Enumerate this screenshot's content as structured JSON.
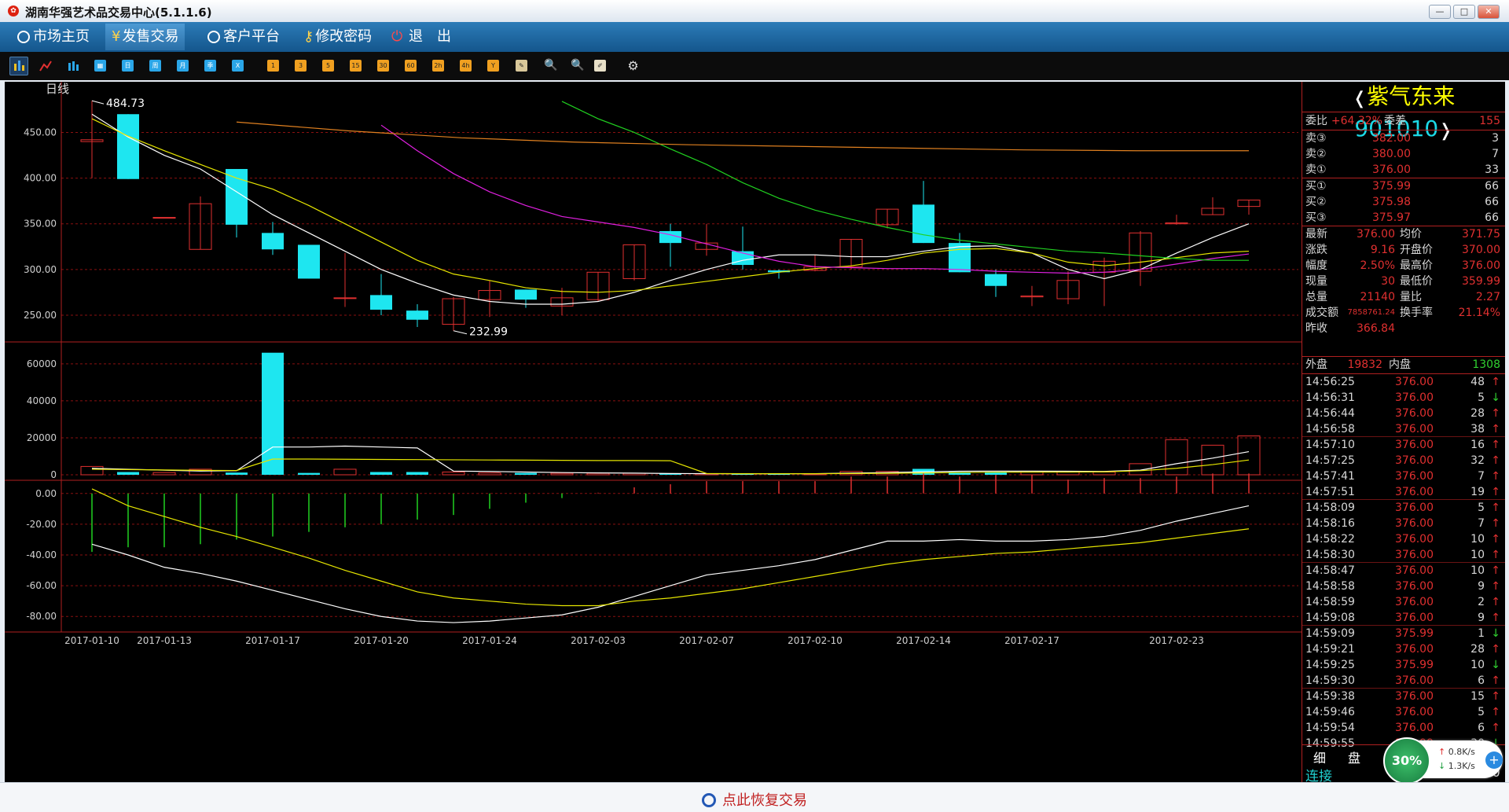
{
  "window": {
    "title": "湖南华强艺术品交易中心(5.1.1.6)"
  },
  "menu": [
    {
      "label": "市场主页",
      "icon": "home-icon"
    },
    {
      "label": "发售交易",
      "icon": "yen-icon"
    },
    {
      "label": "客户平台",
      "icon": "platform-icon"
    },
    {
      "label": "修改密码",
      "icon": "key-icon"
    },
    {
      "label": "退　出",
      "icon": "power-icon"
    }
  ],
  "toolbar": {
    "buttons": [
      "日",
      "周",
      "月",
      "季",
      "X",
      "1",
      "3",
      "5",
      "15",
      "30",
      "60",
      "2h",
      "4h",
      "Y"
    ]
  },
  "chart_data": {
    "type": "candlestick",
    "period_label": "日线",
    "high_label": "484.73",
    "low_label": "232.99",
    "price_axis": [
      "450.00",
      "400.00",
      "350.00",
      "300.00",
      "250.00"
    ],
    "volume_axis": [
      "60000",
      "40000",
      "20000",
      "0"
    ],
    "macd_axis": [
      "0.00",
      "-20.00",
      "-40.00",
      "-60.00",
      "-80.00"
    ],
    "x_labels": [
      "2017-01-10",
      "2017-01-13",
      "2017-01-17",
      "2017-01-20",
      "2017-01-24",
      "2017-02-03",
      "2017-02-07",
      "2017-02-10",
      "2017-02-14",
      "2017-02-17",
      "2017-02-23"
    ],
    "candles": [
      {
        "o": 440,
        "c": 442,
        "h": 484.73,
        "l": 400
      },
      {
        "o": 470,
        "c": 399,
        "h": 470,
        "l": 399
      },
      {
        "o": 357,
        "c": 357,
        "h": 357,
        "l": 357
      },
      {
        "o": 322,
        "c": 372,
        "h": 380,
        "l": 322
      },
      {
        "o": 410,
        "c": 349,
        "h": 410,
        "l": 335
      },
      {
        "o": 340,
        "c": 322,
        "h": 352,
        "l": 316
      },
      {
        "o": 327,
        "c": 290,
        "h": 327,
        "l": 290
      },
      {
        "o": 269,
        "c": 269,
        "h": 318,
        "l": 259
      },
      {
        "o": 272,
        "c": 256,
        "h": 295,
        "l": 250
      },
      {
        "o": 255,
        "c": 245,
        "h": 262,
        "l": 237
      },
      {
        "o": 240,
        "c": 268,
        "h": 270,
        "l": 232.99
      },
      {
        "o": 267,
        "c": 277,
        "h": 288,
        "l": 248
      },
      {
        "o": 278,
        "c": 267,
        "h": 278,
        "l": 258
      },
      {
        "o": 260,
        "c": 269,
        "h": 280,
        "l": 250
      },
      {
        "o": 267,
        "c": 297,
        "h": 297,
        "l": 265
      },
      {
        "o": 290,
        "c": 327,
        "h": 327,
        "l": 288
      },
      {
        "o": 342,
        "c": 329,
        "h": 350,
        "l": 303
      },
      {
        "o": 322,
        "c": 329,
        "h": 350,
        "l": 315
      },
      {
        "o": 320,
        "c": 305,
        "h": 347,
        "l": 300
      },
      {
        "o": 299,
        "c": 297,
        "h": 300,
        "l": 290
      },
      {
        "o": 299,
        "c": 303,
        "h": 316,
        "l": 298
      },
      {
        "o": 303,
        "c": 333,
        "h": 333,
        "l": 300
      },
      {
        "o": 349,
        "c": 366,
        "h": 366,
        "l": 345
      },
      {
        "o": 371,
        "c": 329,
        "h": 397,
        "l": 329
      },
      {
        "o": 329,
        "c": 297,
        "h": 340,
        "l": 297
      },
      {
        "o": 295,
        "c": 282,
        "h": 300,
        "l": 270
      },
      {
        "o": 270,
        "c": 271,
        "h": 282,
        "l": 260
      },
      {
        "o": 268,
        "c": 288,
        "h": 298,
        "l": 262
      },
      {
        "o": 297,
        "c": 309,
        "h": 313,
        "l": 260
      },
      {
        "o": 298,
        "c": 340,
        "h": 342,
        "l": 282
      },
      {
        "o": 350,
        "c": 351,
        "h": 360,
        "l": 349
      },
      {
        "o": 360,
        "c": 367,
        "h": 379,
        "l": 360
      },
      {
        "o": 369,
        "c": 376,
        "h": 376,
        "l": 359.99
      }
    ],
    "ma5": [
      470,
      445,
      425,
      410,
      385,
      360,
      340,
      320,
      300,
      285,
      272,
      265,
      262,
      262,
      265,
      275,
      288,
      300,
      310,
      316,
      316,
      314,
      314,
      320,
      325,
      326,
      318,
      300,
      290,
      300,
      318,
      335,
      350
    ],
    "ma10": [
      465,
      446,
      430,
      415,
      400,
      388,
      370,
      350,
      330,
      310,
      295,
      288,
      280,
      276,
      275,
      277,
      282,
      287,
      292,
      297,
      301,
      304,
      310,
      318,
      322,
      323,
      318,
      308,
      304,
      308,
      313,
      318,
      320
    ],
    "ma20": [
      null,
      null,
      null,
      null,
      null,
      null,
      null,
      null,
      458,
      430,
      405,
      385,
      370,
      358,
      352,
      346,
      338,
      328,
      318,
      309,
      303,
      302,
      301,
      301,
      300,
      298,
      297,
      296,
      297,
      300,
      306,
      312,
      317
    ],
    "ma30": [
      null,
      null,
      null,
      null,
      null,
      null,
      null,
      null,
      null,
      null,
      null,
      null,
      null,
      484,
      465,
      450,
      432,
      415,
      395,
      378,
      365,
      355,
      346,
      338,
      332,
      328,
      324,
      320,
      318,
      315,
      312,
      310,
      310
    ],
    "ma60": [
      null,
      null,
      null,
      null,
      null,
      null,
      null,
      null,
      null,
      null,
      null,
      null,
      null,
      null,
      null,
      null,
      null,
      null,
      null,
      null,
      null,
      null,
      null,
      null,
      null,
      null,
      null,
      null,
      null,
      null,
      null,
      null,
      null
    ],
    "ma60_line": [
      484,
      478,
      470,
      465,
      462,
      460,
      458,
      456,
      455,
      455
    ],
    "volumes": [
      4500,
      1500,
      1200,
      3000,
      1200,
      66000,
      1000,
      3000,
      1500,
      1500,
      1500,
      1000,
      1000,
      800,
      800,
      800,
      600,
      600,
      400,
      400,
      500,
      1800,
      1800,
      3200,
      1500,
      1500,
      1500,
      1500,
      1500,
      6000,
      19000,
      16000,
      21000
    ],
    "macd_hist": [
      -38,
      -35,
      -35,
      -33,
      -30,
      -28,
      -25,
      -22,
      -20,
      -17,
      -14,
      -10,
      -6,
      -3,
      0.5,
      4,
      6,
      8,
      8,
      8,
      8,
      11,
      11,
      13,
      11,
      12,
      12,
      9,
      10,
      10,
      11,
      13,
      13
    ],
    "dif": [
      -33,
      -40,
      -48,
      -52,
      -57,
      -63,
      -69,
      -75,
      -80,
      -83,
      -84,
      -83,
      -81,
      -79,
      -74,
      -67,
      -60,
      -53,
      -50,
      -47,
      -43,
      -37,
      -31,
      -31,
      -30,
      -31,
      -31,
      -30,
      -28,
      -24,
      -18,
      -13,
      -8
    ],
    "dea": [
      3,
      -8,
      -15,
      -22,
      -28,
      -35,
      -42,
      -50,
      -57,
      -64,
      -68,
      -70,
      -72,
      -73,
      -73,
      -70,
      -68,
      -65,
      -62,
      -58,
      -54,
      -50,
      -46,
      -43,
      -41,
      -39,
      -38,
      -36,
      -34,
      -32,
      -29,
      -26,
      -23
    ]
  },
  "quote": {
    "name": "紫气东来",
    "code": "901010",
    "weibi_label": "委比",
    "weibi": "+64.32%",
    "weicha_label": "委差",
    "weicha": "155",
    "asks": [
      {
        "label": "卖③",
        "price": "382.00",
        "vol": "3"
      },
      {
        "label": "卖②",
        "price": "380.00",
        "vol": "7"
      },
      {
        "label": "卖①",
        "price": "376.00",
        "vol": "33"
      }
    ],
    "bids": [
      {
        "label": "买①",
        "price": "375.99",
        "vol": "66"
      },
      {
        "label": "买②",
        "price": "375.98",
        "vol": "66"
      },
      {
        "label": "买③",
        "price": "375.97",
        "vol": "66"
      }
    ],
    "stats": [
      {
        "l1": "最新",
        "v1": "376.00",
        "l2": "均价",
        "v2": "371.75"
      },
      {
        "l1": "涨跌",
        "v1": "9.16",
        "l2": "开盘价",
        "v2": "370.00"
      },
      {
        "l1": "幅度",
        "v1": "2.50%",
        "l2": "最高价",
        "v2": "376.00"
      },
      {
        "l1": "现量",
        "v1": "30",
        "l2": "最低价",
        "v2": "359.99"
      },
      {
        "l1": "总量",
        "v1": "21140",
        "l2": "量比",
        "v2": "2.27"
      },
      {
        "l1": "成交额",
        "v1": "7858761.24",
        "l2": "换手率",
        "v2": "21.14%"
      },
      {
        "l1": "昨收",
        "v1": "366.84",
        "l2": "",
        "v2": ""
      }
    ],
    "outer_label": "外盘",
    "outer": "19832",
    "inner_label": "内盘",
    "inner": "1308"
  },
  "ticks": [
    {
      "t": "14:56:25",
      "p": "376.00",
      "v": "48",
      "d": "up"
    },
    {
      "t": "14:56:31",
      "p": "376.00",
      "v": "5",
      "d": "down"
    },
    {
      "t": "14:56:44",
      "p": "376.00",
      "v": "28",
      "d": "up"
    },
    {
      "t": "14:56:58",
      "p": "376.00",
      "v": "38",
      "d": "up"
    },
    {
      "t": "14:57:10",
      "p": "376.00",
      "v": "16",
      "d": "up"
    },
    {
      "t": "14:57:25",
      "p": "376.00",
      "v": "32",
      "d": "up"
    },
    {
      "t": "14:57:41",
      "p": "376.00",
      "v": "7",
      "d": "up"
    },
    {
      "t": "14:57:51",
      "p": "376.00",
      "v": "19",
      "d": "up"
    },
    {
      "t": "14:58:09",
      "p": "376.00",
      "v": "5",
      "d": "up"
    },
    {
      "t": "14:58:16",
      "p": "376.00",
      "v": "7",
      "d": "up"
    },
    {
      "t": "14:58:22",
      "p": "376.00",
      "v": "10",
      "d": "up"
    },
    {
      "t": "14:58:30",
      "p": "376.00",
      "v": "10",
      "d": "up"
    },
    {
      "t": "14:58:47",
      "p": "376.00",
      "v": "10",
      "d": "up"
    },
    {
      "t": "14:58:58",
      "p": "376.00",
      "v": "9",
      "d": "up"
    },
    {
      "t": "14:58:59",
      "p": "376.00",
      "v": "2",
      "d": "up"
    },
    {
      "t": "14:59:08",
      "p": "376.00",
      "v": "9",
      "d": "up"
    },
    {
      "t": "14:59:09",
      "p": "375.99",
      "v": "1",
      "d": "down"
    },
    {
      "t": "14:59:21",
      "p": "376.00",
      "v": "28",
      "d": "up"
    },
    {
      "t": "14:59:25",
      "p": "375.99",
      "v": "10",
      "d": "down"
    },
    {
      "t": "14:59:30",
      "p": "376.00",
      "v": "6",
      "d": "up"
    },
    {
      "t": "14:59:38",
      "p": "376.00",
      "v": "15",
      "d": "up"
    },
    {
      "t": "14:59:46",
      "p": "376.00",
      "v": "5",
      "d": "up"
    },
    {
      "t": "14:59:54",
      "p": "376.00",
      "v": "6",
      "d": "up"
    },
    {
      "t": "14:59:55",
      "p": "375.99",
      "v": "30",
      "d": "down"
    }
  ],
  "tabs": {
    "detail": "细",
    "pan": "盘",
    "status": "连接",
    "time_tail": ":00"
  },
  "speed": {
    "percent": "30%",
    "up": "0.8K/s",
    "down": "1.3K/s"
  },
  "footer": {
    "restore": "点此恢复交易"
  },
  "colors": {
    "up": "#e03030",
    "down": "#1ee6f0",
    "ma5": "#ffffff",
    "ma10": "#e6e600",
    "ma20": "#e020e0",
    "ma30": "#20d020",
    "ma60": "#e08020",
    "grid": "#8a1010"
  }
}
